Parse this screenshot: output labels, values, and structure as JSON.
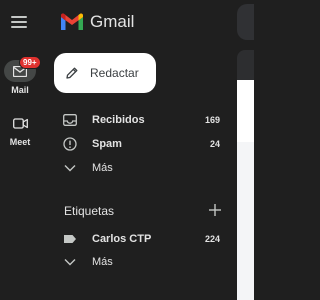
{
  "app": {
    "name": "Gmail"
  },
  "rail": {
    "mail": {
      "label": "Mail",
      "badge": "99+"
    },
    "meet": {
      "label": "Meet"
    }
  },
  "compose": {
    "label": "Redactar"
  },
  "nav": [
    {
      "label": "Recibidos",
      "count": "169"
    },
    {
      "label": "Spam",
      "count": "24"
    },
    {
      "label": "Más"
    }
  ],
  "labels": {
    "title": "Etiquetas",
    "items": [
      {
        "label": "Carlos CTP",
        "count": "224"
      },
      {
        "label": "Más"
      }
    ]
  },
  "colors": {
    "background": "#1f1f1f",
    "badge": "#e0322f",
    "compose_bg": "#ffffff"
  }
}
